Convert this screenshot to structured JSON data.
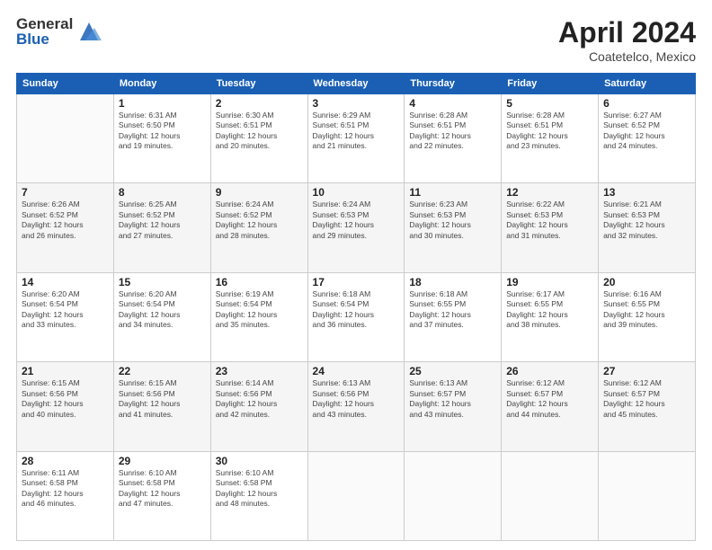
{
  "logo": {
    "general": "General",
    "blue": "Blue"
  },
  "title": {
    "month": "April 2024",
    "location": "Coatetelco, Mexico"
  },
  "weekdays": [
    "Sunday",
    "Monday",
    "Tuesday",
    "Wednesday",
    "Thursday",
    "Friday",
    "Saturday"
  ],
  "weeks": [
    [
      {
        "day": null,
        "info": null
      },
      {
        "day": "1",
        "info": "Sunrise: 6:31 AM\nSunset: 6:50 PM\nDaylight: 12 hours\nand 19 minutes."
      },
      {
        "day": "2",
        "info": "Sunrise: 6:30 AM\nSunset: 6:51 PM\nDaylight: 12 hours\nand 20 minutes."
      },
      {
        "day": "3",
        "info": "Sunrise: 6:29 AM\nSunset: 6:51 PM\nDaylight: 12 hours\nand 21 minutes."
      },
      {
        "day": "4",
        "info": "Sunrise: 6:28 AM\nSunset: 6:51 PM\nDaylight: 12 hours\nand 22 minutes."
      },
      {
        "day": "5",
        "info": "Sunrise: 6:28 AM\nSunset: 6:51 PM\nDaylight: 12 hours\nand 23 minutes."
      },
      {
        "day": "6",
        "info": "Sunrise: 6:27 AM\nSunset: 6:52 PM\nDaylight: 12 hours\nand 24 minutes."
      }
    ],
    [
      {
        "day": "7",
        "info": "Sunrise: 6:26 AM\nSunset: 6:52 PM\nDaylight: 12 hours\nand 26 minutes."
      },
      {
        "day": "8",
        "info": "Sunrise: 6:25 AM\nSunset: 6:52 PM\nDaylight: 12 hours\nand 27 minutes."
      },
      {
        "day": "9",
        "info": "Sunrise: 6:24 AM\nSunset: 6:52 PM\nDaylight: 12 hours\nand 28 minutes."
      },
      {
        "day": "10",
        "info": "Sunrise: 6:24 AM\nSunset: 6:53 PM\nDaylight: 12 hours\nand 29 minutes."
      },
      {
        "day": "11",
        "info": "Sunrise: 6:23 AM\nSunset: 6:53 PM\nDaylight: 12 hours\nand 30 minutes."
      },
      {
        "day": "12",
        "info": "Sunrise: 6:22 AM\nSunset: 6:53 PM\nDaylight: 12 hours\nand 31 minutes."
      },
      {
        "day": "13",
        "info": "Sunrise: 6:21 AM\nSunset: 6:53 PM\nDaylight: 12 hours\nand 32 minutes."
      }
    ],
    [
      {
        "day": "14",
        "info": "Sunrise: 6:20 AM\nSunset: 6:54 PM\nDaylight: 12 hours\nand 33 minutes."
      },
      {
        "day": "15",
        "info": "Sunrise: 6:20 AM\nSunset: 6:54 PM\nDaylight: 12 hours\nand 34 minutes."
      },
      {
        "day": "16",
        "info": "Sunrise: 6:19 AM\nSunset: 6:54 PM\nDaylight: 12 hours\nand 35 minutes."
      },
      {
        "day": "17",
        "info": "Sunrise: 6:18 AM\nSunset: 6:54 PM\nDaylight: 12 hours\nand 36 minutes."
      },
      {
        "day": "18",
        "info": "Sunrise: 6:18 AM\nSunset: 6:55 PM\nDaylight: 12 hours\nand 37 minutes."
      },
      {
        "day": "19",
        "info": "Sunrise: 6:17 AM\nSunset: 6:55 PM\nDaylight: 12 hours\nand 38 minutes."
      },
      {
        "day": "20",
        "info": "Sunrise: 6:16 AM\nSunset: 6:55 PM\nDaylight: 12 hours\nand 39 minutes."
      }
    ],
    [
      {
        "day": "21",
        "info": "Sunrise: 6:15 AM\nSunset: 6:56 PM\nDaylight: 12 hours\nand 40 minutes."
      },
      {
        "day": "22",
        "info": "Sunrise: 6:15 AM\nSunset: 6:56 PM\nDaylight: 12 hours\nand 41 minutes."
      },
      {
        "day": "23",
        "info": "Sunrise: 6:14 AM\nSunset: 6:56 PM\nDaylight: 12 hours\nand 42 minutes."
      },
      {
        "day": "24",
        "info": "Sunrise: 6:13 AM\nSunset: 6:56 PM\nDaylight: 12 hours\nand 43 minutes."
      },
      {
        "day": "25",
        "info": "Sunrise: 6:13 AM\nSunset: 6:57 PM\nDaylight: 12 hours\nand 43 minutes."
      },
      {
        "day": "26",
        "info": "Sunrise: 6:12 AM\nSunset: 6:57 PM\nDaylight: 12 hours\nand 44 minutes."
      },
      {
        "day": "27",
        "info": "Sunrise: 6:12 AM\nSunset: 6:57 PM\nDaylight: 12 hours\nand 45 minutes."
      }
    ],
    [
      {
        "day": "28",
        "info": "Sunrise: 6:11 AM\nSunset: 6:58 PM\nDaylight: 12 hours\nand 46 minutes."
      },
      {
        "day": "29",
        "info": "Sunrise: 6:10 AM\nSunset: 6:58 PM\nDaylight: 12 hours\nand 47 minutes."
      },
      {
        "day": "30",
        "info": "Sunrise: 6:10 AM\nSunset: 6:58 PM\nDaylight: 12 hours\nand 48 minutes."
      },
      {
        "day": null,
        "info": null
      },
      {
        "day": null,
        "info": null
      },
      {
        "day": null,
        "info": null
      },
      {
        "day": null,
        "info": null
      }
    ]
  ]
}
